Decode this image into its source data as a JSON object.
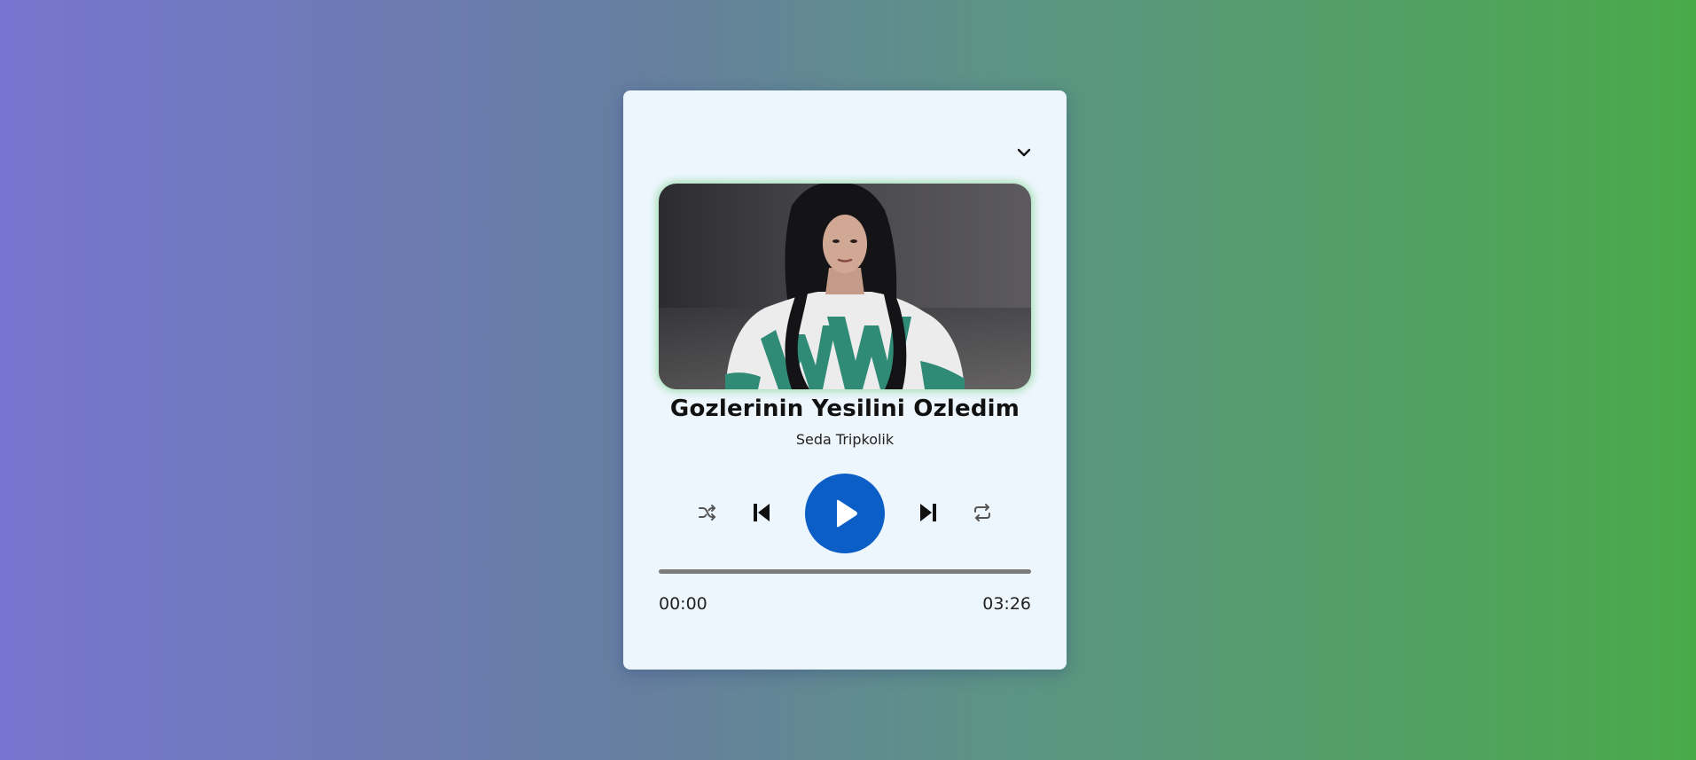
{
  "player": {
    "song_title": "Gozlerinin Yesilini Ozledim",
    "artist": "Seda Tripkolik",
    "current_time": "00:00",
    "total_time": "03:26",
    "progress": 0,
    "accent_color": "#0a5ec6",
    "card_background": "#eef6fd",
    "icons": {
      "collapse": "chevron-down-icon",
      "shuffle": "shuffle-icon",
      "previous": "skip-previous-icon",
      "play": "play-icon",
      "next": "skip-next-icon",
      "repeat": "repeat-icon"
    }
  }
}
